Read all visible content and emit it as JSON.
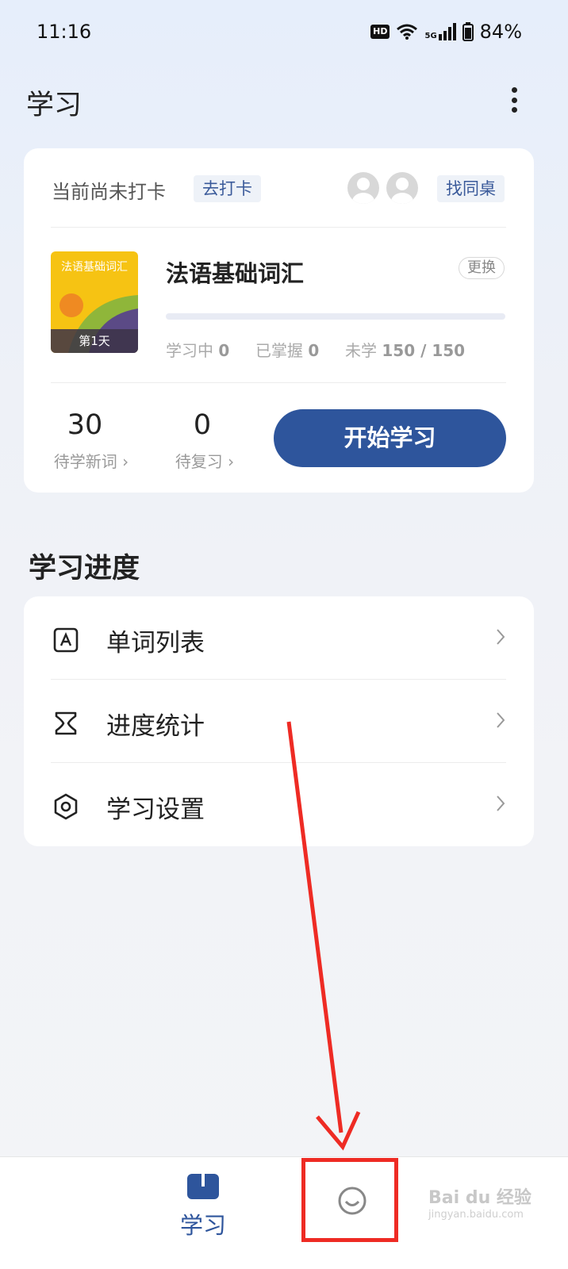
{
  "status_bar": {
    "time": "11:16",
    "hd": "HD",
    "network": "5G",
    "battery": "84%"
  },
  "header": {
    "title": "学习"
  },
  "checkin": {
    "status_text": "当前尚未打卡",
    "checkin_button": "去打卡",
    "find_partner_button": "找同桌"
  },
  "book": {
    "cover_title": "法语基础词汇",
    "day_label": "第1天",
    "name": "法语基础词汇",
    "switch_button": "更换",
    "progress": 0,
    "stats": {
      "learning_label": "学习中",
      "learning_value": "0",
      "mastered_label": "已掌握",
      "mastered_value": "0",
      "unlearned_label": "未学",
      "unlearned_value": "150 / 150"
    }
  },
  "counts": {
    "new_words_value": "30",
    "new_words_label": "待学新词 ›",
    "review_value": "0",
    "review_label": "待复习 ›"
  },
  "start_button": "开始学习",
  "progress_section": {
    "title": "学习进度",
    "items": [
      {
        "label": "单词列表",
        "icon": "word-list-icon"
      },
      {
        "label": "进度统计",
        "icon": "hourglass-icon"
      },
      {
        "label": "学习设置",
        "icon": "settings-hexagon-icon"
      }
    ]
  },
  "tabbar": {
    "items": [
      {
        "label": "学习",
        "icon": "book-icon",
        "active": true
      },
      {
        "label": "",
        "icon": "smile-icon",
        "active": false
      }
    ],
    "accent": "#2e559c"
  },
  "annotation": {
    "color": "#ee2b24"
  },
  "watermark": {
    "text": "Bai du 经验",
    "sub": "jingyan.baidu.com"
  }
}
